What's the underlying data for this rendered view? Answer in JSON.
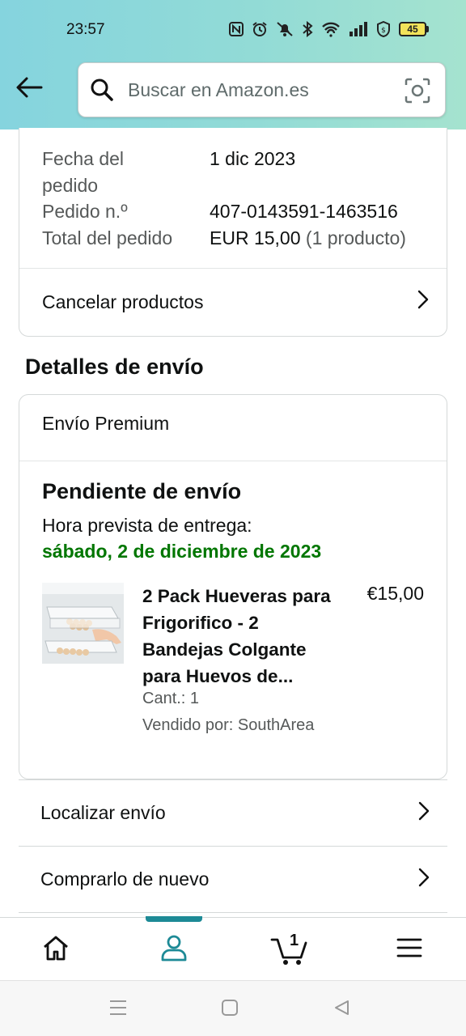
{
  "status_bar": {
    "time": "23:57",
    "battery_level": "45",
    "icons": [
      "nfc-icon",
      "alarm-icon",
      "silent-icon",
      "bluetooth-icon",
      "wifi-icon",
      "signal-icon",
      "vpn-shield-icon",
      "battery-icon"
    ]
  },
  "header": {
    "back_icon": "arrow-left-icon",
    "search_placeholder": "Buscar en Amazon.es",
    "camera_icon": "camera-scan-icon"
  },
  "order_summary": {
    "date_label": "Fecha del pedido",
    "date_value": "1 dic 2023",
    "number_label": "Pedido n.º",
    "number_value": "407-0143591-1463516",
    "total_label": "Total del pedido",
    "total_value": "EUR 15,00",
    "total_items": "(1 producto)",
    "cancel_label": "Cancelar productos"
  },
  "shipping": {
    "section_title": "Detalles de envío",
    "type": "Envío Premium",
    "status": "Pendiente de envío",
    "eta_label": "Hora prevista de entrega:",
    "eta_date": "sábado, 2 de diciembre de 2023",
    "status_color": "#007600"
  },
  "product": {
    "title": "2 Pack Hueveras para Frigorifico - 2 Bandejas Colgante para Huevos de...",
    "price": "€15,00",
    "quantity": "Cant.: 1",
    "seller": "Vendido por: SouthArea"
  },
  "actions": {
    "track": "Localizar envío",
    "buy_again": "Comprarlo de nuevo"
  },
  "bottom_nav": {
    "items": [
      "home-icon",
      "account-icon",
      "cart-icon",
      "menu-icon"
    ],
    "active": "account-icon",
    "cart_count": "1",
    "accent_color": "#1d8a96"
  },
  "system_nav": {
    "items": [
      "recent-apps-icon",
      "home-square-icon",
      "back-triangle-icon"
    ]
  }
}
